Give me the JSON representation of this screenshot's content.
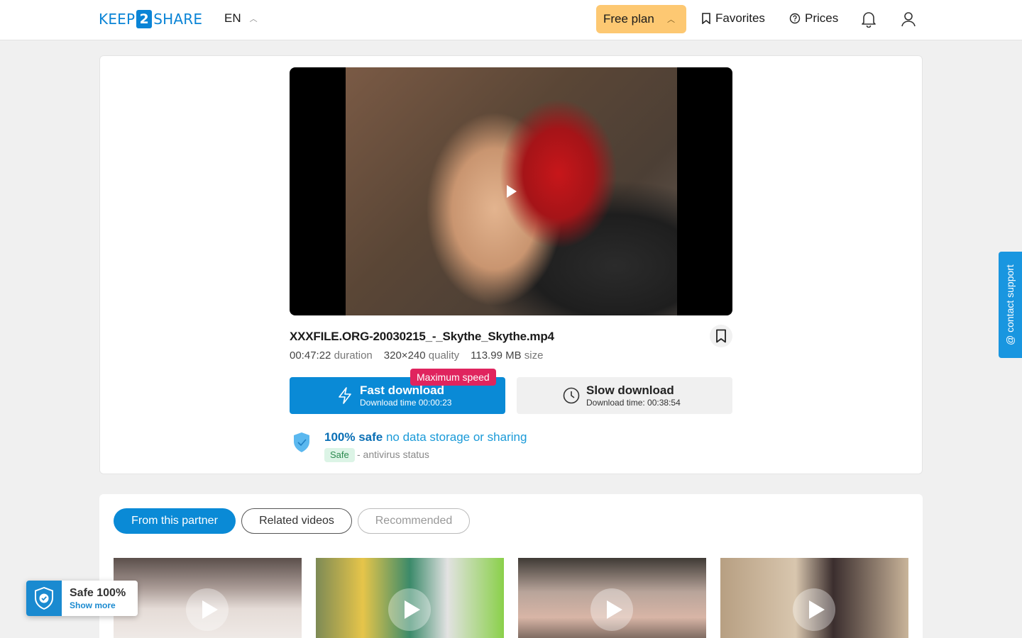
{
  "header": {
    "logo_left": "KEEP",
    "logo_num": "2",
    "logo_right": "SHARE",
    "language": "EN",
    "plan_label": "Free plan",
    "favorites_label": "Favorites",
    "prices_label": "Prices"
  },
  "file": {
    "name": "XXXFILE.ORG-20030215_-_Skythe_Skythe.mp4",
    "duration_value": "00:47:22",
    "duration_label": "duration",
    "quality_value": "320×240",
    "quality_label": "quality",
    "size_value": "113.99 MB",
    "size_label": "size"
  },
  "downloads": {
    "fast_label": "Fast download",
    "fast_time": "Download time 00:00:23",
    "badge": "Maximum speed",
    "slow_label": "Slow download",
    "slow_time": "Download time: 00:38:54"
  },
  "safety": {
    "bold": "100% safe",
    "text": "no data storage or sharing",
    "pill": "Safe",
    "status": "- antivirus status"
  },
  "tabs": [
    "From this partner",
    "Related videos",
    "Recommended"
  ],
  "support_label": "@ contact support",
  "safe_badge": {
    "title": "Safe 100%",
    "link": "Show more"
  },
  "colors": {
    "accent": "#0a8ad6",
    "plan_bg": "#fdc872",
    "badge_red": "#e0245e",
    "safe_green": "#dcf4e6"
  }
}
